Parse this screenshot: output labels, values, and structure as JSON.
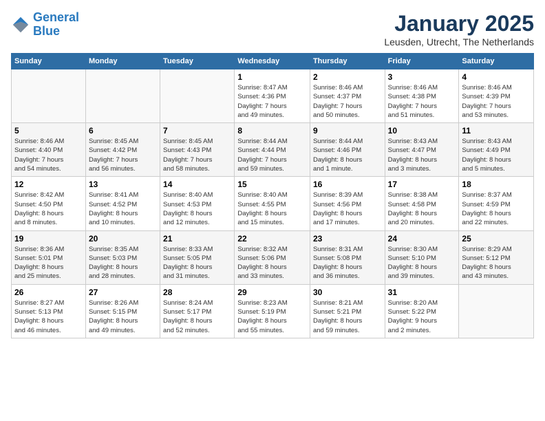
{
  "header": {
    "logo_line1": "General",
    "logo_line2": "Blue",
    "title": "January 2025",
    "subtitle": "Leusden, Utrecht, The Netherlands"
  },
  "columns": [
    "Sunday",
    "Monday",
    "Tuesday",
    "Wednesday",
    "Thursday",
    "Friday",
    "Saturday"
  ],
  "weeks": [
    {
      "days": [
        {
          "number": "",
          "info": ""
        },
        {
          "number": "",
          "info": ""
        },
        {
          "number": "",
          "info": ""
        },
        {
          "number": "1",
          "info": "Sunrise: 8:47 AM\nSunset: 4:36 PM\nDaylight: 7 hours\nand 49 minutes."
        },
        {
          "number": "2",
          "info": "Sunrise: 8:46 AM\nSunset: 4:37 PM\nDaylight: 7 hours\nand 50 minutes."
        },
        {
          "number": "3",
          "info": "Sunrise: 8:46 AM\nSunset: 4:38 PM\nDaylight: 7 hours\nand 51 minutes."
        },
        {
          "number": "4",
          "info": "Sunrise: 8:46 AM\nSunset: 4:39 PM\nDaylight: 7 hours\nand 53 minutes."
        }
      ]
    },
    {
      "days": [
        {
          "number": "5",
          "info": "Sunrise: 8:46 AM\nSunset: 4:40 PM\nDaylight: 7 hours\nand 54 minutes."
        },
        {
          "number": "6",
          "info": "Sunrise: 8:45 AM\nSunset: 4:42 PM\nDaylight: 7 hours\nand 56 minutes."
        },
        {
          "number": "7",
          "info": "Sunrise: 8:45 AM\nSunset: 4:43 PM\nDaylight: 7 hours\nand 58 minutes."
        },
        {
          "number": "8",
          "info": "Sunrise: 8:44 AM\nSunset: 4:44 PM\nDaylight: 7 hours\nand 59 minutes."
        },
        {
          "number": "9",
          "info": "Sunrise: 8:44 AM\nSunset: 4:46 PM\nDaylight: 8 hours\nand 1 minute."
        },
        {
          "number": "10",
          "info": "Sunrise: 8:43 AM\nSunset: 4:47 PM\nDaylight: 8 hours\nand 3 minutes."
        },
        {
          "number": "11",
          "info": "Sunrise: 8:43 AM\nSunset: 4:49 PM\nDaylight: 8 hours\nand 5 minutes."
        }
      ]
    },
    {
      "days": [
        {
          "number": "12",
          "info": "Sunrise: 8:42 AM\nSunset: 4:50 PM\nDaylight: 8 hours\nand 8 minutes."
        },
        {
          "number": "13",
          "info": "Sunrise: 8:41 AM\nSunset: 4:52 PM\nDaylight: 8 hours\nand 10 minutes."
        },
        {
          "number": "14",
          "info": "Sunrise: 8:40 AM\nSunset: 4:53 PM\nDaylight: 8 hours\nand 12 minutes."
        },
        {
          "number": "15",
          "info": "Sunrise: 8:40 AM\nSunset: 4:55 PM\nDaylight: 8 hours\nand 15 minutes."
        },
        {
          "number": "16",
          "info": "Sunrise: 8:39 AM\nSunset: 4:56 PM\nDaylight: 8 hours\nand 17 minutes."
        },
        {
          "number": "17",
          "info": "Sunrise: 8:38 AM\nSunset: 4:58 PM\nDaylight: 8 hours\nand 20 minutes."
        },
        {
          "number": "18",
          "info": "Sunrise: 8:37 AM\nSunset: 4:59 PM\nDaylight: 8 hours\nand 22 minutes."
        }
      ]
    },
    {
      "days": [
        {
          "number": "19",
          "info": "Sunrise: 8:36 AM\nSunset: 5:01 PM\nDaylight: 8 hours\nand 25 minutes."
        },
        {
          "number": "20",
          "info": "Sunrise: 8:35 AM\nSunset: 5:03 PM\nDaylight: 8 hours\nand 28 minutes."
        },
        {
          "number": "21",
          "info": "Sunrise: 8:33 AM\nSunset: 5:05 PM\nDaylight: 8 hours\nand 31 minutes."
        },
        {
          "number": "22",
          "info": "Sunrise: 8:32 AM\nSunset: 5:06 PM\nDaylight: 8 hours\nand 33 minutes."
        },
        {
          "number": "23",
          "info": "Sunrise: 8:31 AM\nSunset: 5:08 PM\nDaylight: 8 hours\nand 36 minutes."
        },
        {
          "number": "24",
          "info": "Sunrise: 8:30 AM\nSunset: 5:10 PM\nDaylight: 8 hours\nand 39 minutes."
        },
        {
          "number": "25",
          "info": "Sunrise: 8:29 AM\nSunset: 5:12 PM\nDaylight: 8 hours\nand 43 minutes."
        }
      ]
    },
    {
      "days": [
        {
          "number": "26",
          "info": "Sunrise: 8:27 AM\nSunset: 5:13 PM\nDaylight: 8 hours\nand 46 minutes."
        },
        {
          "number": "27",
          "info": "Sunrise: 8:26 AM\nSunset: 5:15 PM\nDaylight: 8 hours\nand 49 minutes."
        },
        {
          "number": "28",
          "info": "Sunrise: 8:24 AM\nSunset: 5:17 PM\nDaylight: 8 hours\nand 52 minutes."
        },
        {
          "number": "29",
          "info": "Sunrise: 8:23 AM\nSunset: 5:19 PM\nDaylight: 8 hours\nand 55 minutes."
        },
        {
          "number": "30",
          "info": "Sunrise: 8:21 AM\nSunset: 5:21 PM\nDaylight: 8 hours\nand 59 minutes."
        },
        {
          "number": "31",
          "info": "Sunrise: 8:20 AM\nSunset: 5:22 PM\nDaylight: 9 hours\nand 2 minutes."
        },
        {
          "number": "",
          "info": ""
        }
      ]
    }
  ]
}
